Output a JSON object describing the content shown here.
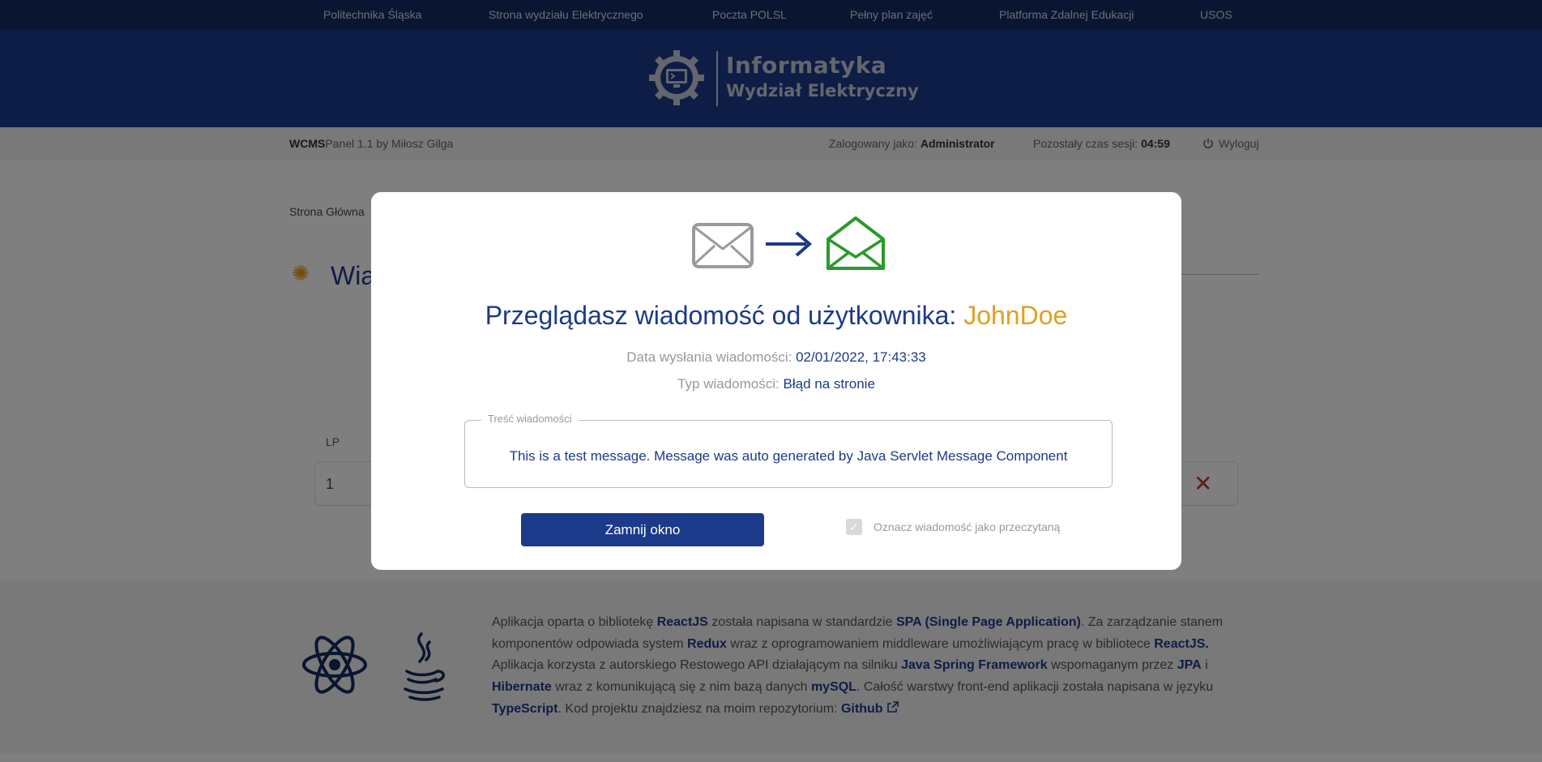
{
  "topnav": {
    "links": [
      "Politechnika Śląska",
      "Strona wydziału Elektrycznego",
      "Poczta POLSL",
      "Pełny plan zajęć",
      "Platforma Zdalnej Edukacji",
      "USOS"
    ]
  },
  "header": {
    "title": "Informatyka",
    "subtitle": "Wydział Elektryczny"
  },
  "statusbar": {
    "brand_bold": "WCMS",
    "brand_rest": "Panel 1.1 by Miłosz Gilga",
    "logged_label": "Zalogowany jako:",
    "logged_user": "Administrator",
    "session_label": "Pozostały czas sesji:",
    "session_time": "04:59",
    "logout": "Wyloguj"
  },
  "main": {
    "breadcrumb": "Strona Główna",
    "title": "Wia",
    "col_lp": "LP",
    "row_number": "1"
  },
  "modal": {
    "title_prefix": "Przeglądasz wiadomość od użytkownika:",
    "user": "JohnDoe",
    "date_label": "Data wysłania wiadomości:",
    "date_value": "02/01/2022, 17:43:33",
    "type_label": "Typ wiadomości:",
    "type_value": "Błąd na stronie",
    "content_legend": "Treść wiadomości",
    "content": "This is a test message. Message was auto generated by Java Servlet Message Component",
    "close_button": "Zamnij okno",
    "mark_read_label": "Oznacz wiadomość jako przeczytaną",
    "mark_read_checked": true
  },
  "footer": {
    "t1": "Aplikacja oparta o bibliotekę ",
    "k1": "ReactJS",
    "t2": " została napisana w standardzie ",
    "k2": "SPA (Single Page Application)",
    "t3": ". Za zarządzanie stanem komponentów odpowiada system ",
    "k3": "Redux",
    "t4": " wraz z oprogramowaniem middleware umożliwiającym pracę w bibliotece ",
    "k4": "ReactJS.",
    "t5": " Aplikacja korzysta z autorskiego Restowego API działającym na silniku ",
    "k5": "Java Spring Framework",
    "t6": " wspomaganym przez ",
    "k6": "JPA",
    "t7": " i ",
    "k7": "Hibernate",
    "t8": " wraz z komunikującą się z nim bazą danych ",
    "k8": "mySQL",
    "t9": ". Całość warstwy front-end aplikacji została napisana w języku ",
    "k9": "TypeScript",
    "t10": ". Kod projektu znajdziesz na moim repozytorium: ",
    "k10": "Github",
    "link_icon": "external-link-icon"
  },
  "colors": {
    "navy": "#132a63",
    "header_blue": "#1c3a8a",
    "accent_gold": "#e0a020",
    "mail_green": "#2a9a2a",
    "delete_red": "#c0392b"
  }
}
